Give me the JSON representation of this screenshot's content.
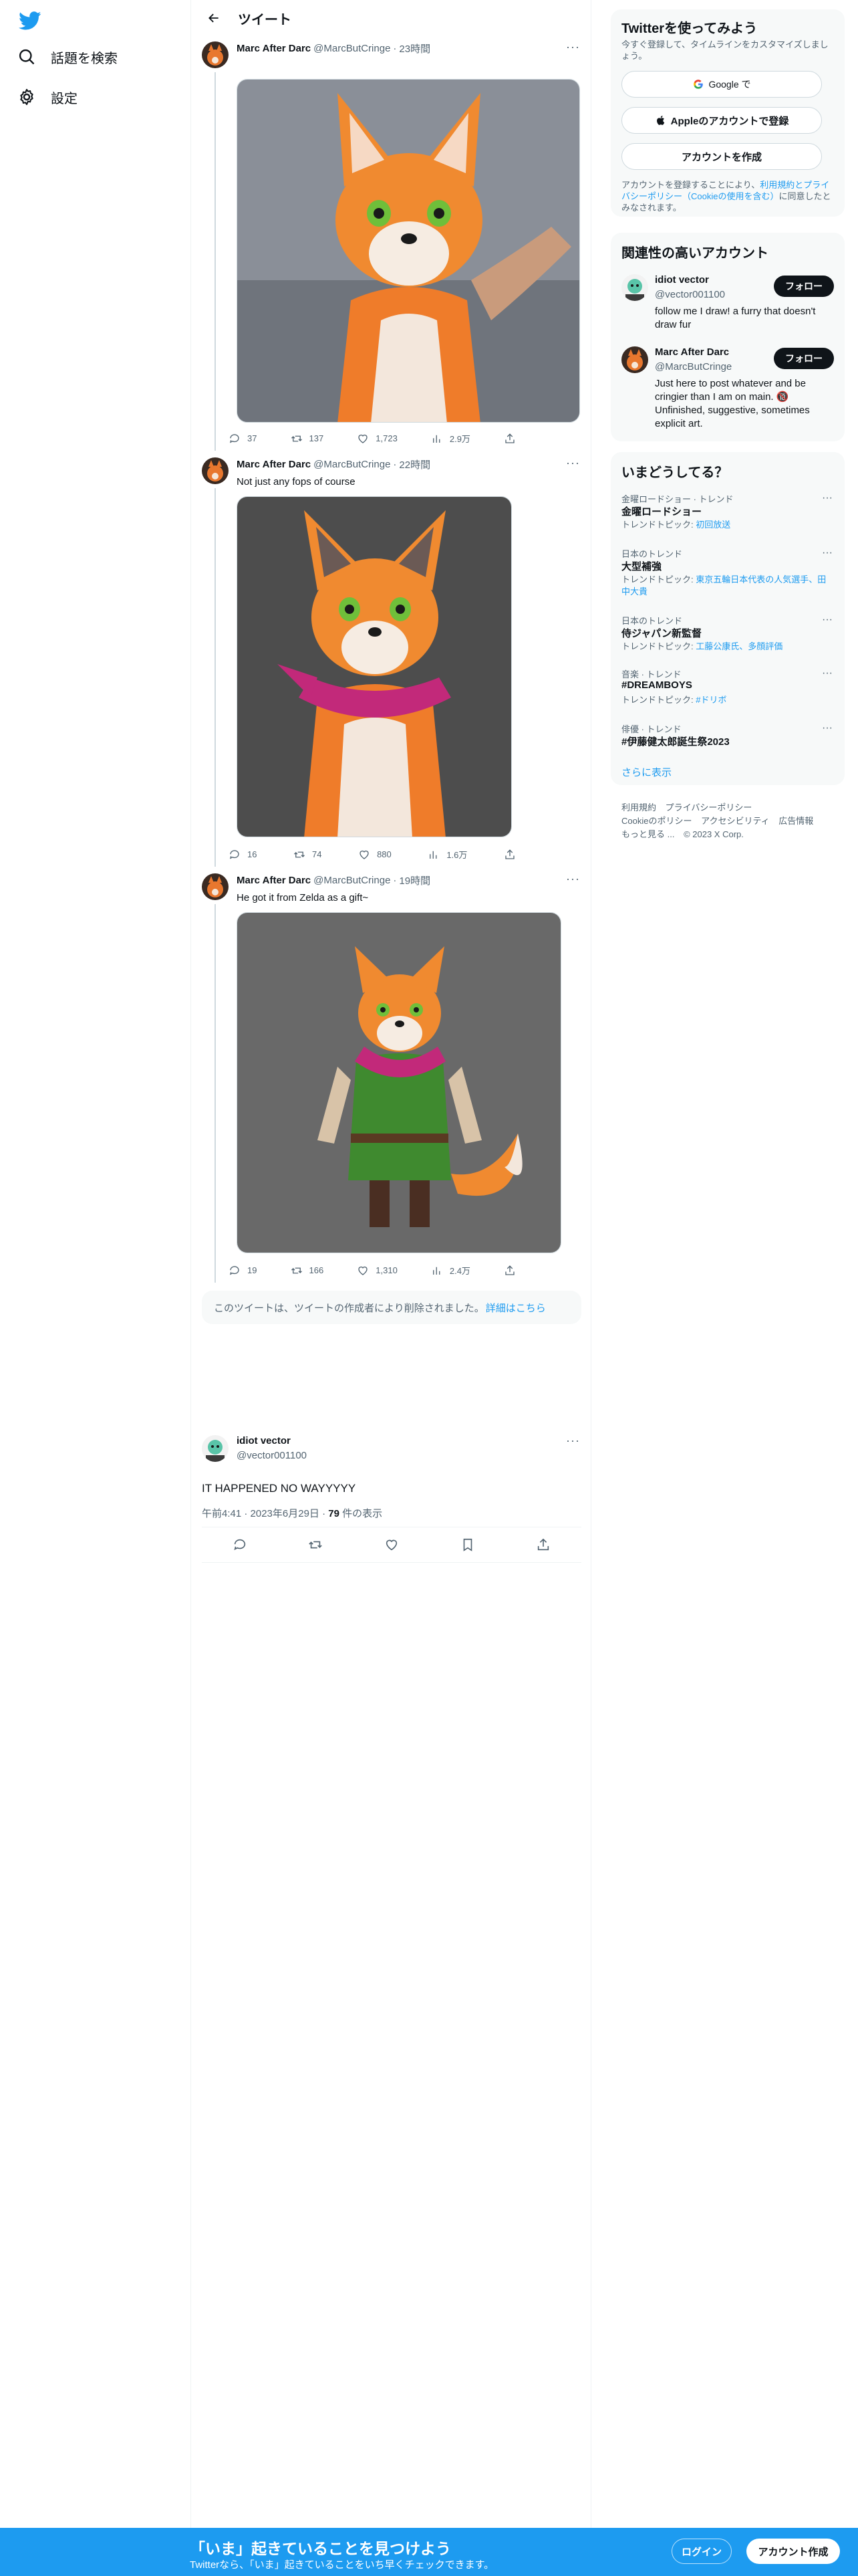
{
  "nav": {
    "items": [
      {
        "label": "話題を検索"
      },
      {
        "label": "設定"
      }
    ]
  },
  "header": {
    "title": "ツイート"
  },
  "tweets": [
    {
      "name": "Marc After Darc",
      "handle": "@MarcButCringe",
      "time": "23時間",
      "text": "",
      "replies": "37",
      "retweets": "137",
      "likes": "1,723",
      "views": "2.9万"
    },
    {
      "name": "Marc After Darc",
      "handle": "@MarcButCringe",
      "time": "22時間",
      "text": "Not just any fops of course",
      "replies": "16",
      "retweets": "74",
      "likes": "880",
      "views": "1.6万"
    },
    {
      "name": "Marc After Darc",
      "handle": "@MarcButCringe",
      "time": "19時間",
      "text": "He got it from Zelda as a gift~",
      "replies": "19",
      "retweets": "166",
      "likes": "1,310",
      "views": "2.4万"
    }
  ],
  "dot_separator": "·",
  "more_glyph": "···",
  "deleted": {
    "text": "このツイートは、ツイートの作成者により削除されました。",
    "link": "詳細はこちら"
  },
  "focus": {
    "name": "idiot vector",
    "handle": "@vector001100",
    "text": "IT HAPPENED NO WAYYYYY",
    "time": "午前4:41 · 2023年6月29日 · ",
    "views_count": "79",
    "views_label": " 件の表示"
  },
  "signup": {
    "title": "Twitterを使ってみよう",
    "desc": "今すぐ登録して、タイムラインをカスタマイズしましょう。",
    "google": "Google で",
    "apple": "Appleのアカウントで登録",
    "create": "アカウントを作成",
    "legal_1": "アカウントを登録することにより、",
    "legal_terms": "利用規約",
    "legal_and": "と",
    "legal_privacy": "プライバシーポリシー",
    "legal_cookie": "（Cookieの使用を含む）",
    "legal_2": "に同意したとみなされます。"
  },
  "recommended": {
    "title": "関連性の高いアカウント",
    "accounts": [
      {
        "name": "idiot vector",
        "handle": "@vector001100",
        "bio": "follow me I draw! a furry that doesn't draw fur",
        "follow": "フォロー"
      },
      {
        "name": "Marc After Darc",
        "handle": "@MarcButCringe",
        "bio": "Just here to post whatever and be cringier than I am on main. 🔞 Unfinished, suggestive, sometimes explicit art.",
        "follow": "フォロー"
      }
    ]
  },
  "trends": {
    "title": "いまどうしてる？",
    "items": [
      {
        "category": "金曜ロードショー · トレンド",
        "title": "金曜ロードショー",
        "sub_prefix": "トレンドトピック: ",
        "sub_link": "初回放送"
      },
      {
        "category": "日本のトレンド",
        "title": "大型補強",
        "sub_prefix": "トレンドトピック: ",
        "sub_link": "東京五輪日本代表の人気選手、田中大貴"
      },
      {
        "category": "日本のトレンド",
        "title": "侍ジャパン新監督",
        "sub_prefix": "トレンドトピック: ",
        "sub_link": "工藤公康氏、多顔評価"
      },
      {
        "category": "音楽 · トレンド",
        "title": "#DREAMBOYS",
        "sub_prefix": "トレンドトピック: ",
        "sub_link": "#ドリボ"
      },
      {
        "category": "俳優 · トレンド",
        "title": "#伊藤健太郎誕生祭2023",
        "sub_prefix": "",
        "sub_link": ""
      }
    ],
    "show_more": "さらに表示"
  },
  "footer": {
    "links": [
      "利用規約",
      "プライバシーポリシー",
      "Cookieのポリシー",
      "アクセシビリティ",
      "広告情報",
      "もっと見る ...",
      "© 2023 X Corp."
    ]
  },
  "bottombar": {
    "title": "「いま」起きていることを見つけよう",
    "sub": "Twitterなら、「いま」起きていることをいち早くチェックできます。",
    "login": "ログイン",
    "signup": "アカウント作成"
  },
  "colors": {
    "accent": "#1d9bf0",
    "text": "#0f1419",
    "muted": "#536471"
  }
}
